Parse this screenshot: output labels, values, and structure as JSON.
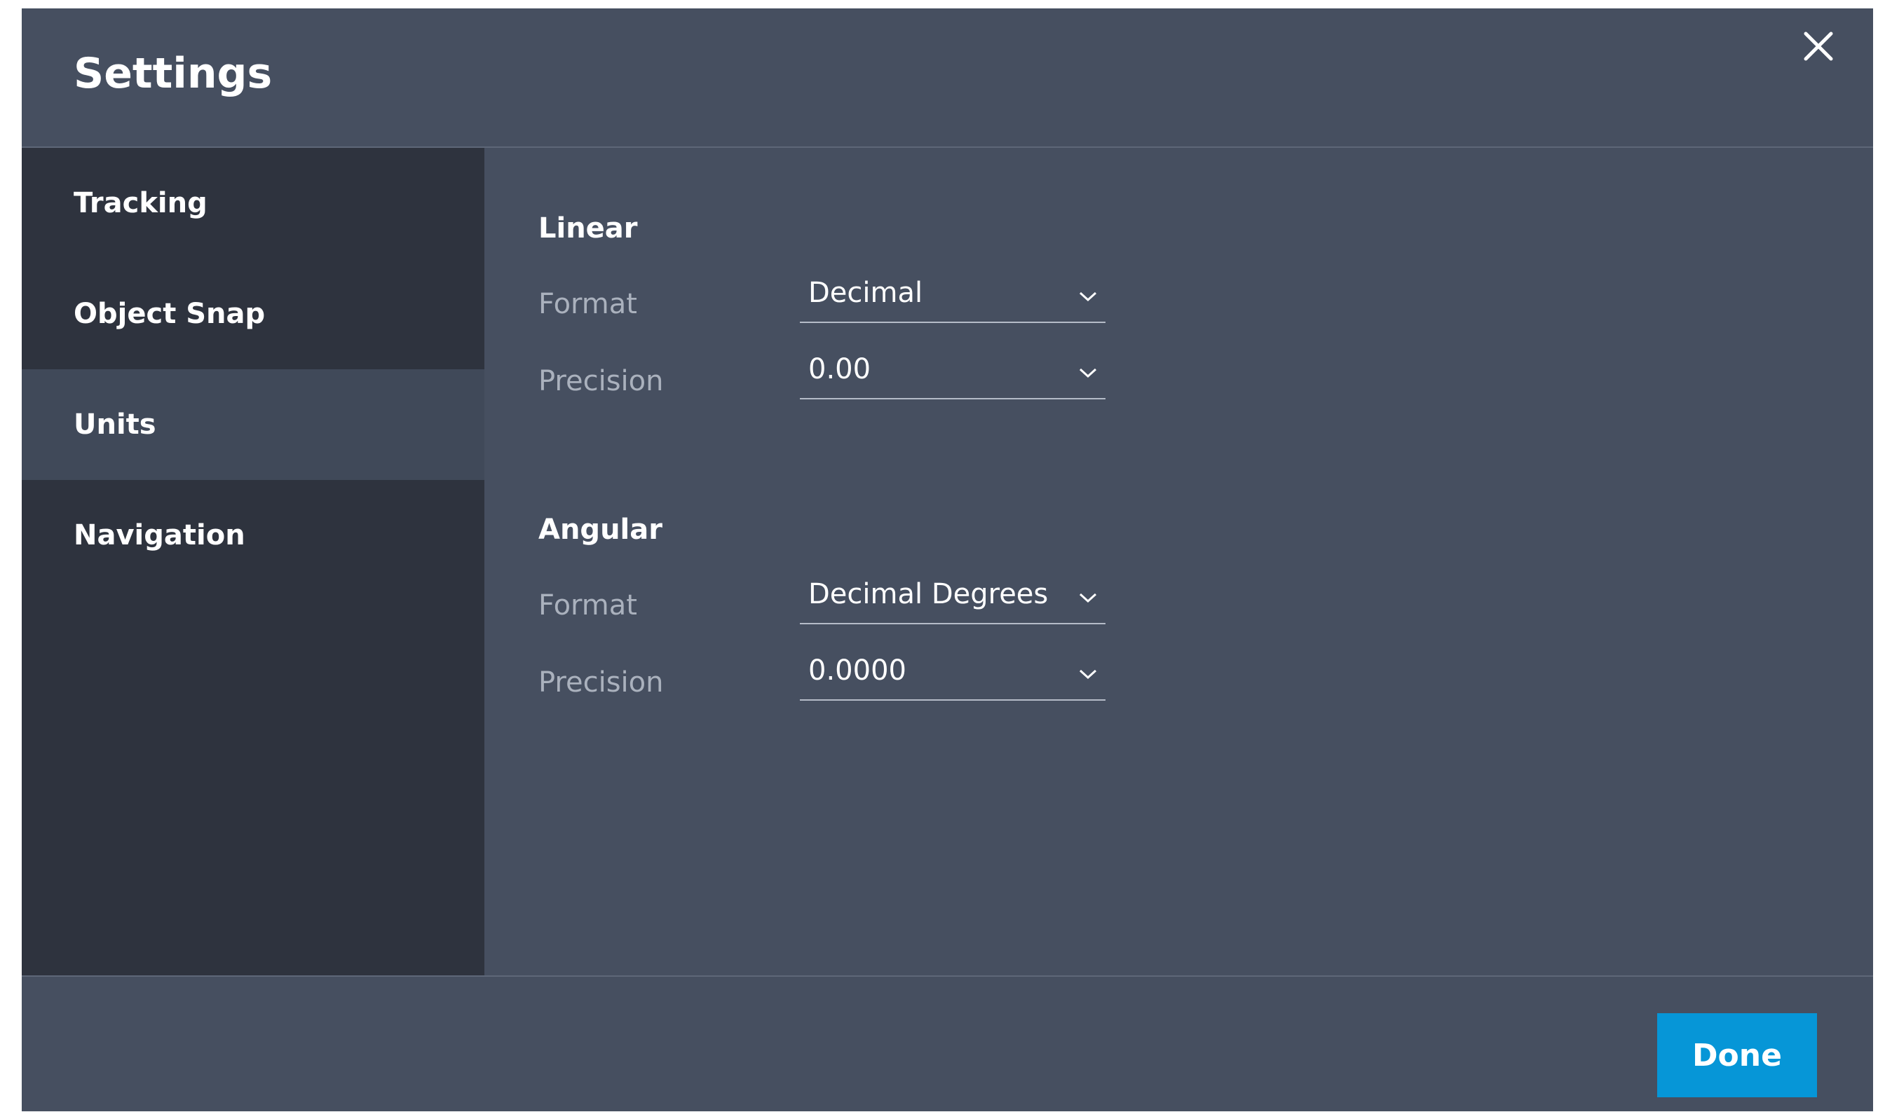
{
  "dialog": {
    "title": "Settings",
    "close_icon": "close-icon"
  },
  "sidebar": {
    "items": [
      {
        "label": "Tracking",
        "active": false
      },
      {
        "label": "Object Snap",
        "active": false
      },
      {
        "label": "Units",
        "active": true
      },
      {
        "label": "Navigation",
        "active": false
      }
    ]
  },
  "units": {
    "linear": {
      "title": "Linear",
      "format_label": "Format",
      "format_value": "Decimal",
      "precision_label": "Precision",
      "precision_value": "0.00"
    },
    "angular": {
      "title": "Angular",
      "format_label": "Format",
      "format_value": "Decimal Degrees",
      "precision_label": "Precision",
      "precision_value": "0.0000"
    }
  },
  "footer": {
    "done_label": "Done"
  },
  "colors": {
    "dialog_bg": "#464f60",
    "sidebar_bg": "#2e333e",
    "sidebar_active_bg": "#404959",
    "accent": "#0696d7"
  }
}
